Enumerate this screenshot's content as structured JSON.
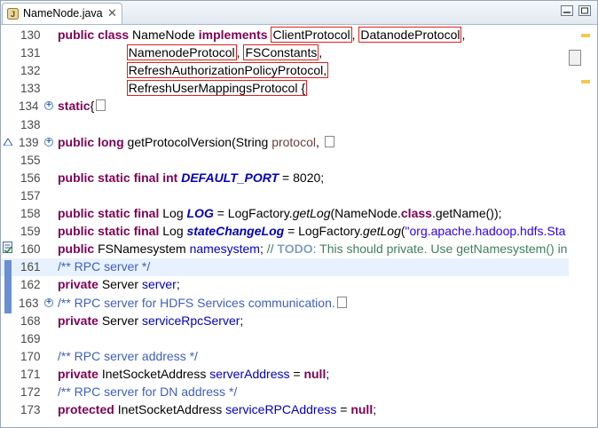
{
  "tab": {
    "title": "NameNode.java",
    "close_glyph": "✕"
  },
  "lines": [
    {
      "n": "130",
      "fold": "",
      "parts": [
        [
          "kw",
          "public class "
        ],
        [
          "",
          "NameNode "
        ],
        [
          "kw",
          "implements "
        ],
        [
          "box",
          "ClientProtocol"
        ],
        [
          "",
          ", "
        ],
        [
          "box",
          "DatanodeProtocol"
        ],
        [
          "",
          ","
        ]
      ]
    },
    {
      "n": "131",
      "fold": "",
      "parts": [
        [
          "",
          "                    "
        ],
        [
          "box",
          "NamenodeProtocol"
        ],
        [
          "",
          ", "
        ],
        [
          "box",
          "FSConstants"
        ],
        [
          "",
          ","
        ]
      ]
    },
    {
      "n": "132",
      "fold": "",
      "parts": [
        [
          "",
          "                    "
        ],
        [
          "box",
          "RefreshAuthorizationPolicyProtocol,"
        ]
      ]
    },
    {
      "n": "133",
      "fold": "",
      "parts": [
        [
          "",
          "                    "
        ],
        [
          "box",
          "RefreshUserMappingsProtocol {"
        ]
      ]
    },
    {
      "n": "134",
      "fold": "+",
      "parts": [
        [
          "kw",
          "static"
        ],
        [
          "",
          "{"
        ],
        [
          "collapsed",
          ""
        ]
      ]
    },
    {
      "n": "138",
      "fold": "",
      "parts": []
    },
    {
      "n": "139",
      "fold": "+",
      "parts": [
        [
          "kw",
          "public long "
        ],
        [
          "",
          "getProtocolVersion(String "
        ],
        [
          "param",
          "protocol"
        ],
        [
          "",
          ", "
        ],
        [
          "collapsed",
          ""
        ]
      ]
    },
    {
      "n": "155",
      "fold": "",
      "parts": []
    },
    {
      "n": "156",
      "fold": "",
      "parts": [
        [
          "kw",
          "public static final int "
        ],
        [
          "sfld",
          "DEFAULT_PORT"
        ],
        [
          "",
          " = 8020;"
        ]
      ]
    },
    {
      "n": "157",
      "fold": "",
      "parts": []
    },
    {
      "n": "158",
      "fold": "",
      "parts": [
        [
          "kw",
          "public static final "
        ],
        [
          "",
          "Log "
        ],
        [
          "sfld",
          "LOG"
        ],
        [
          "",
          " = LogFactory."
        ],
        [
          "smeth",
          "getLog"
        ],
        [
          "",
          "(NameNode."
        ],
        [
          "kw",
          "class"
        ],
        [
          "",
          ".getName());"
        ]
      ]
    },
    {
      "n": "159",
      "fold": "",
      "parts": [
        [
          "kw",
          "public static final "
        ],
        [
          "",
          "Log "
        ],
        [
          "sfld",
          "stateChangeLog"
        ],
        [
          "",
          " = LogFactory."
        ],
        [
          "smeth",
          "getLog"
        ],
        [
          "",
          "("
        ],
        [
          "str",
          "\"org.apache.hadoop.hdfs.Sta"
        ]
      ]
    },
    {
      "n": "160",
      "fold": "",
      "parts": [
        [
          "kw",
          "public "
        ],
        [
          "",
          "FSNamesystem "
        ],
        [
          "fld",
          "namesystem"
        ],
        [
          "",
          "; "
        ],
        [
          "lcmt",
          "// "
        ],
        [
          "todo",
          "TODO"
        ],
        [
          "lcmt",
          ": This should private. Use getNamesystem() in"
        ]
      ]
    },
    {
      "n": "161",
      "fold": "",
      "hl": true,
      "parts": [
        [
          "cmt",
          "/** RPC server */"
        ]
      ]
    },
    {
      "n": "162",
      "fold": "",
      "parts": [
        [
          "kw",
          "private "
        ],
        [
          "",
          "Server "
        ],
        [
          "fld",
          "server"
        ],
        [
          "",
          ";"
        ]
      ]
    },
    {
      "n": "163",
      "fold": "+",
      "parts": [
        [
          "cmt",
          "/** RPC server for HDFS Services communication."
        ],
        [
          "collapsed",
          ""
        ]
      ]
    },
    {
      "n": "168",
      "fold": "",
      "parts": [
        [
          "kw",
          "private "
        ],
        [
          "",
          "Server "
        ],
        [
          "fld",
          "serviceRpcServer"
        ],
        [
          "",
          ";"
        ]
      ]
    },
    {
      "n": "169",
      "fold": "",
      "parts": []
    },
    {
      "n": "170",
      "fold": "",
      "parts": [
        [
          "cmt",
          "/** RPC server address */"
        ]
      ]
    },
    {
      "n": "171",
      "fold": "",
      "parts": [
        [
          "kw",
          "private "
        ],
        [
          "",
          "InetSocketAddress "
        ],
        [
          "fld",
          "serverAddress"
        ],
        [
          "",
          " = "
        ],
        [
          "kw",
          "null"
        ],
        [
          "",
          ";"
        ]
      ]
    },
    {
      "n": "172",
      "fold": "",
      "parts": [
        [
          "cmt",
          "/** RPC server for DN address */"
        ]
      ]
    },
    {
      "n": "173",
      "fold": "",
      "parts": [
        [
          "kw",
          "protected "
        ],
        [
          "",
          "InetSocketAddress "
        ],
        [
          "fld",
          "serviceRPCAddress"
        ],
        [
          "",
          " = "
        ],
        [
          "kw",
          "null"
        ],
        [
          "",
          ";"
        ]
      ]
    }
  ],
  "colors": {
    "keyword": "#7f0055",
    "field": "#0000c0",
    "comment": "#3f5fbf",
    "string": "#2a00ff",
    "highlight": "#e8f2fe",
    "annotation_box": "#e02020"
  }
}
